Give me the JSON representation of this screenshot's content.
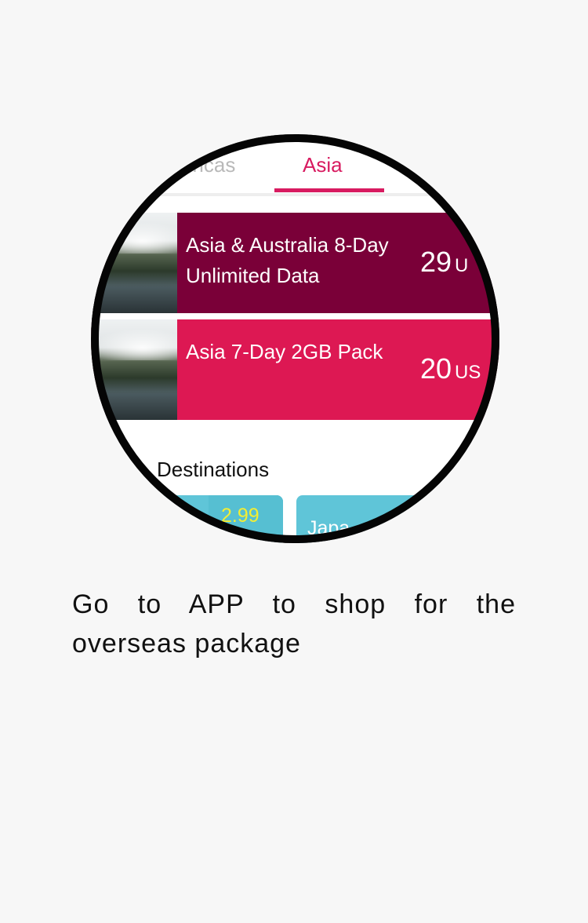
{
  "tabs": {
    "partial": "ericas",
    "active": "Asia"
  },
  "packages": [
    {
      "title": "Asia & Australia 8-Day Unlimited Data",
      "price": "29",
      "currency": "U"
    },
    {
      "title": "Asia 7-Day 2GB Pack",
      "price": "20",
      "currency": "US"
    }
  ],
  "destinations": {
    "section_title": "Destinations",
    "tiles": [
      {
        "price": "2.99"
      },
      {
        "name": "Japa"
      }
    ]
  },
  "caption": {
    "line1": "Go to APP to shop for the",
    "line2": "overseas package"
  },
  "colors": {
    "accent": "#d81b60",
    "card_dark": "#7a0038",
    "card_bright": "#dd1853",
    "tile": "#5fc5d8",
    "tile_price": "#f4ee32"
  }
}
